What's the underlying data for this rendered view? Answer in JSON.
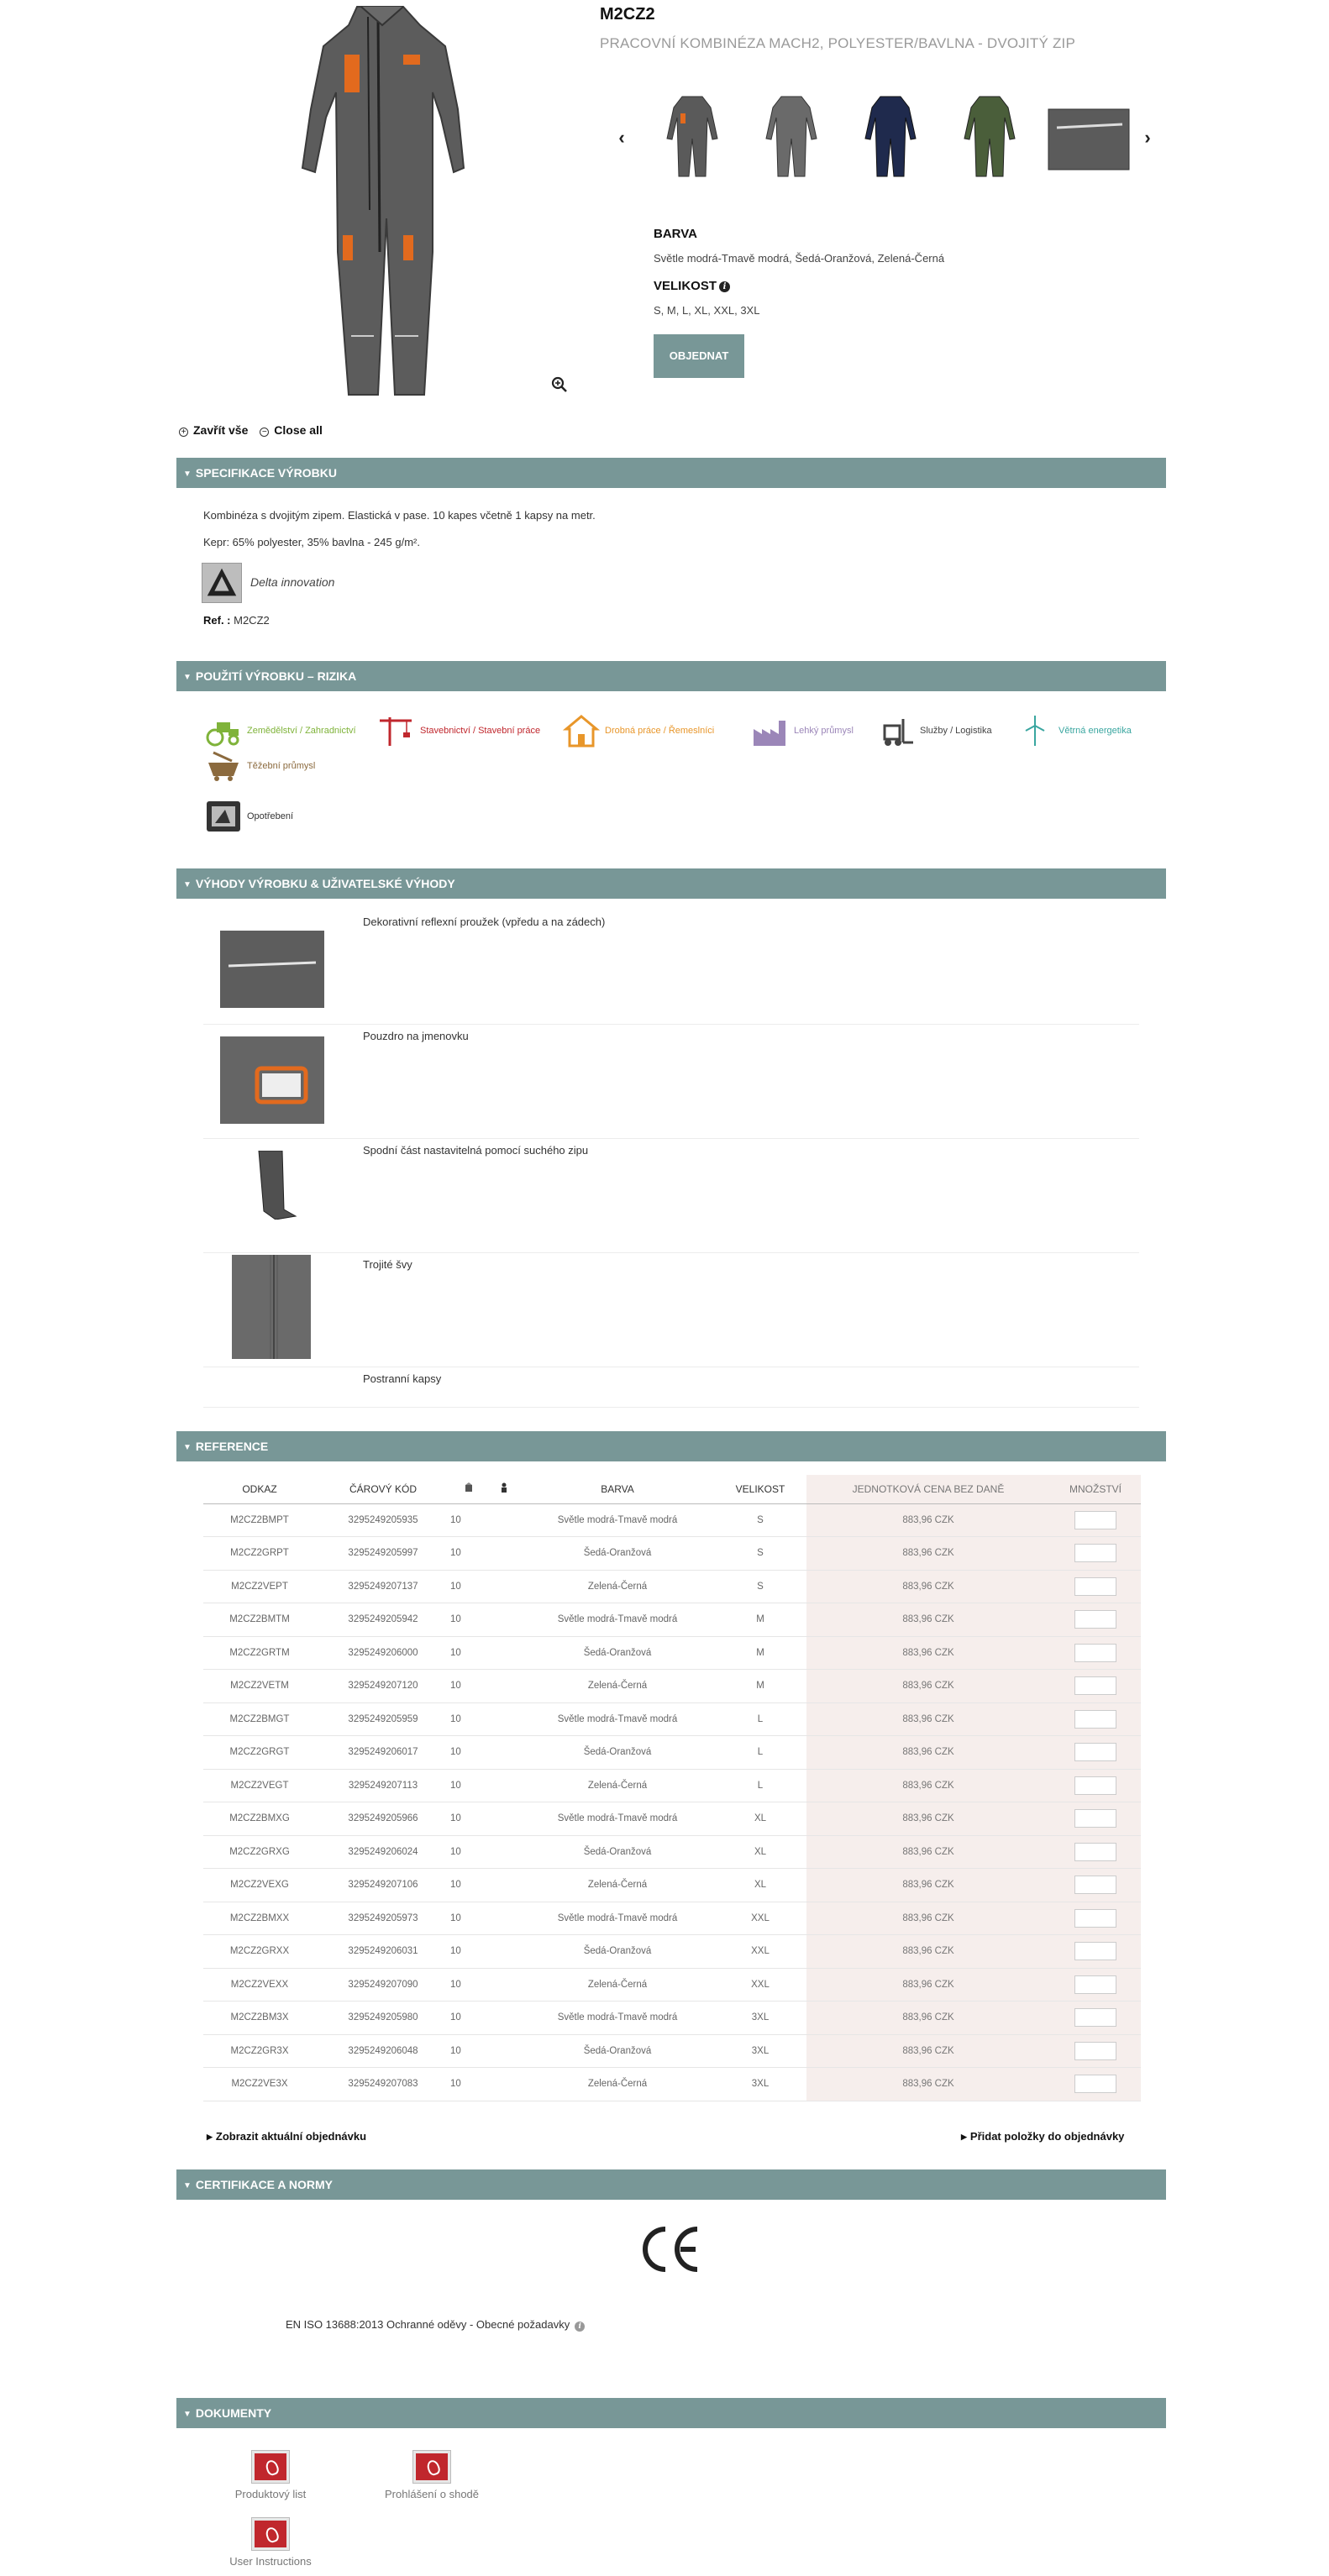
{
  "product": {
    "ref": "M2CZ2",
    "name": "PRACOVNÍ KOMBINÉZA MACH2, POLYESTER/BAVLNA - DVOJITÝ ZIP",
    "color_label": "BARVA",
    "colors": "Světle modrá-Tmavě modrá, Šedá-Oranžová, Zelená-Černá",
    "size_label": "VELIKOST",
    "sizes": "S, M, L, XL, XXL, 3XL",
    "order_button": "OBJEDNAT"
  },
  "toggles": {
    "expand_all": "Zavřít vše",
    "close_all": "Close all"
  },
  "sections": {
    "spec": "SPECIFIKACE VÝROBKU",
    "usage": "POUŽITÍ VÝROBKU – RIZIKA",
    "benefits": "VÝHODY VÝROBKU & UŽIVATELSKÉ VÝHODY",
    "reference": "REFERENCE",
    "certification": "CERTIFIKACE A NORMY",
    "documents": "DOKUMENTY"
  },
  "spec": {
    "line1": "Kombinéza s dvojitým zipem. Elastická v pase. 10 kapes včetně 1 kapsy na metr.",
    "line2": "Kepr: 65% polyester, 35% bavlna - 245 g/m².",
    "delta_label": "Delta innovation",
    "ref_label": "Ref. :",
    "ref_value": "M2CZ2"
  },
  "usage": [
    {
      "label": "Zemědělství / Zahradnictví",
      "color": "#7fb33a"
    },
    {
      "label": "Stavebnictví / Stavební práce",
      "color": "#c0272d"
    },
    {
      "label": "Drobná práce / Řemeslníci",
      "color": "#e8962a"
    },
    {
      "label": "Lehký průmysl",
      "color": "#9b86b8"
    },
    {
      "label": "Služby / Logistika",
      "color": "#444444"
    },
    {
      "label": "Větrná energetika",
      "color": "#3aa6a0"
    },
    {
      "label": "Těžební průmysl",
      "color": "#8b6a3e"
    },
    {
      "label": "Opotřebení",
      "color": "#333333"
    }
  ],
  "benefits": [
    "Dekorativní reflexní proužek (vpředu a na zádech)",
    "Pouzdro na jmenovku",
    "Spodní část nastavitelná pomocí suchého zipu",
    "Trojité švy",
    "Postranní kapsy"
  ],
  "table": {
    "headers": {
      "order": "ODKAZ",
      "ean": "ČÁROVÝ KÓD",
      "color": "BARVA",
      "size": "VELIKOST",
      "price": "JEDNOTKOVÁ CENA BEZ DANĚ",
      "qty": "MNOŽSTVÍ"
    },
    "rows": [
      {
        "code": "M2CZ2BMPT",
        "ean": "3295249205935",
        "pack": "10",
        "color": "Světle modrá-Tmavě modrá",
        "size": "S",
        "price": "883,96 CZK"
      },
      {
        "code": "M2CZ2GRPT",
        "ean": "3295249205997",
        "pack": "10",
        "color": "Šedá-Oranžová",
        "size": "S",
        "price": "883,96 CZK"
      },
      {
        "code": "M2CZ2VEPT",
        "ean": "3295249207137",
        "pack": "10",
        "color": "Zelená-Černá",
        "size": "S",
        "price": "883,96 CZK"
      },
      {
        "code": "M2CZ2BMTM",
        "ean": "3295249205942",
        "pack": "10",
        "color": "Světle modrá-Tmavě modrá",
        "size": "M",
        "price": "883,96 CZK"
      },
      {
        "code": "M2CZ2GRTM",
        "ean": "3295249206000",
        "pack": "10",
        "color": "Šedá-Oranžová",
        "size": "M",
        "price": "883,96 CZK"
      },
      {
        "code": "M2CZ2VETM",
        "ean": "3295249207120",
        "pack": "10",
        "color": "Zelená-Černá",
        "size": "M",
        "price": "883,96 CZK"
      },
      {
        "code": "M2CZ2BMGT",
        "ean": "3295249205959",
        "pack": "10",
        "color": "Světle modrá-Tmavě modrá",
        "size": "L",
        "price": "883,96 CZK"
      },
      {
        "code": "M2CZ2GRGT",
        "ean": "3295249206017",
        "pack": "10",
        "color": "Šedá-Oranžová",
        "size": "L",
        "price": "883,96 CZK"
      },
      {
        "code": "M2CZ2VEGT",
        "ean": "3295249207113",
        "pack": "10",
        "color": "Zelená-Černá",
        "size": "L",
        "price": "883,96 CZK"
      },
      {
        "code": "M2CZ2BMXG",
        "ean": "3295249205966",
        "pack": "10",
        "color": "Světle modrá-Tmavě modrá",
        "size": "XL",
        "price": "883,96 CZK"
      },
      {
        "code": "M2CZ2GRXG",
        "ean": "3295249206024",
        "pack": "10",
        "color": "Šedá-Oranžová",
        "size": "XL",
        "price": "883,96 CZK"
      },
      {
        "code": "M2CZ2VEXG",
        "ean": "3295249207106",
        "pack": "10",
        "color": "Zelená-Černá",
        "size": "XL",
        "price": "883,96 CZK"
      },
      {
        "code": "M2CZ2BMXX",
        "ean": "3295249205973",
        "pack": "10",
        "color": "Světle modrá-Tmavě modrá",
        "size": "XXL",
        "price": "883,96 CZK"
      },
      {
        "code": "M2CZ2GRXX",
        "ean": "3295249206031",
        "pack": "10",
        "color": "Šedá-Oranžová",
        "size": "XXL",
        "price": "883,96 CZK"
      },
      {
        "code": "M2CZ2VEXX",
        "ean": "3295249207090",
        "pack": "10",
        "color": "Zelená-Černá",
        "size": "XXL",
        "price": "883,96 CZK"
      },
      {
        "code": "M2CZ2BM3X",
        "ean": "3295249205980",
        "pack": "10",
        "color": "Světle modrá-Tmavě modrá",
        "size": "3XL",
        "price": "883,96 CZK"
      },
      {
        "code": "M2CZ2GR3X",
        "ean": "3295249206048",
        "pack": "10",
        "color": "Šedá-Oranžová",
        "size": "3XL",
        "price": "883,96 CZK"
      },
      {
        "code": "M2CZ2VE3X",
        "ean": "3295249207083",
        "pack": "10",
        "color": "Zelená-Černá",
        "size": "3XL",
        "price": "883,96 CZK"
      }
    ],
    "show_order": "Zobrazit aktuální objednávku",
    "add_items": "Přidat položky do objednávky"
  },
  "certification": {
    "norm": "EN ISO 13688:2013 Ochranné oděvy - Obecné požadavky"
  },
  "documents": [
    "Produktový list",
    "Prohlášení o shodě",
    "User Instructions"
  ],
  "colors": {
    "accent": "#789797",
    "price_bg": "#f6eeec"
  }
}
